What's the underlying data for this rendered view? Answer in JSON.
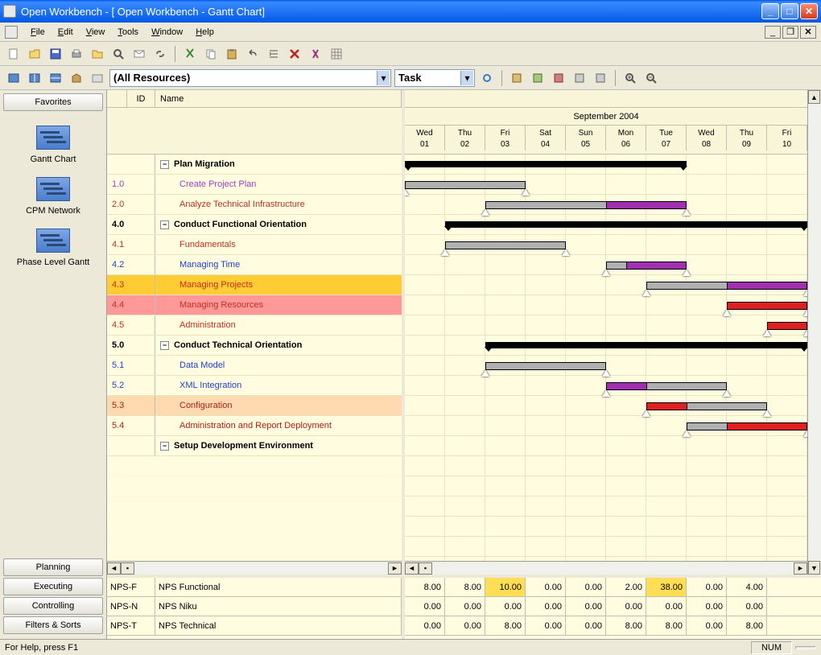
{
  "window": {
    "title": "Open Workbench - [   Open Workbench - Gantt Chart]"
  },
  "menu": {
    "file": "File",
    "edit": "Edit",
    "view": "View",
    "tools": "Tools",
    "window": "Window",
    "help": "Help"
  },
  "toolbar2": {
    "resources_combo": "(All Resources)",
    "view_type_combo": "Task"
  },
  "sidebar": {
    "categories": {
      "favorites": "Favorites",
      "planning": "Planning",
      "executing": "Executing",
      "controlling": "Controlling",
      "filters": "Filters & Sorts"
    },
    "views": [
      {
        "label": "Gantt Chart"
      },
      {
        "label": "CPM Network"
      },
      {
        "label": "Phase Level Gantt"
      }
    ]
  },
  "grid": {
    "headers": {
      "id": "ID",
      "name": "Name"
    },
    "month": "September 2004",
    "days": [
      {
        "dow": "Wed",
        "num": "01"
      },
      {
        "dow": "Thu",
        "num": "02"
      },
      {
        "dow": "Fri",
        "num": "03"
      },
      {
        "dow": "Sat",
        "num": "04"
      },
      {
        "dow": "Sun",
        "num": "05"
      },
      {
        "dow": "Mon",
        "num": "06"
      },
      {
        "dow": "Tue",
        "num": "07"
      },
      {
        "dow": "Wed",
        "num": "08"
      },
      {
        "dow": "Thu",
        "num": "09"
      },
      {
        "dow": "Fri",
        "num": "10"
      }
    ],
    "tasks": [
      {
        "id": "",
        "name": "Plan Migration",
        "bold": true,
        "toggle": true
      },
      {
        "id": "1.0",
        "name": "Create Project Plan",
        "color": "c-purple"
      },
      {
        "id": "2.0",
        "name": "Analyze Technical Infrastructure",
        "color": "c-red"
      },
      {
        "id": "4.0",
        "name": "Conduct Functional Orientation",
        "bold": true,
        "toggle": true
      },
      {
        "id": "4.1",
        "name": "Fundamentals",
        "color": "c-red"
      },
      {
        "id": "4.2",
        "name": "Managing Time",
        "color": "c-blue"
      },
      {
        "id": "4.3",
        "name": "Managing Projects",
        "color": "c-red",
        "hl": "hl-orange"
      },
      {
        "id": "4.4",
        "name": "Managing Resources",
        "color": "c-red",
        "hl": "hl-pink"
      },
      {
        "id": "4.5",
        "name": "Administration",
        "color": "c-red"
      },
      {
        "id": "5.0",
        "name": "Conduct Technical Orientation",
        "bold": true,
        "toggle": true
      },
      {
        "id": "5.1",
        "name": "Data Model",
        "color": "c-blue"
      },
      {
        "id": "5.2",
        "name": "XML Integration",
        "color": "c-blue"
      },
      {
        "id": "5.3",
        "name": "Configuration",
        "color": "c-dred",
        "hl": "hl-lred"
      },
      {
        "id": "5.4",
        "name": "Administration and Report Deployment",
        "color": "c-dred"
      },
      {
        "id": "",
        "name": "Setup Development Environment",
        "bold": true,
        "toggle": true
      }
    ]
  },
  "resources": {
    "rows": [
      {
        "code": "NPS-F",
        "name": "NPS Functional",
        "values": [
          "8.00",
          "8.00",
          "10.00",
          "0.00",
          "0.00",
          "2.00",
          "38.00",
          "0.00",
          "4.00"
        ]
      },
      {
        "code": "NPS-N",
        "name": "NPS Niku",
        "values": [
          "0.00",
          "0.00",
          "0.00",
          "0.00",
          "0.00",
          "0.00",
          "0.00",
          "0.00",
          "0.00"
        ]
      },
      {
        "code": "NPS-T",
        "name": "NPS Technical",
        "values": [
          "0.00",
          "0.00",
          "8.00",
          "0.00",
          "0.00",
          "8.00",
          "8.00",
          "0.00",
          "8.00"
        ]
      }
    ],
    "highlight": {
      "row": 0,
      "cols": [
        2,
        6
      ]
    }
  },
  "status": {
    "help": "For Help, press F1",
    "num": "NUM"
  },
  "chart_data": {
    "type": "gantt",
    "title": "Open Workbench - Gantt Chart",
    "time_axis": {
      "label": "September 2004",
      "ticks": [
        "01",
        "02",
        "03",
        "04",
        "05",
        "06",
        "07",
        "08",
        "09",
        "10"
      ]
    },
    "tasks": [
      {
        "id": "",
        "name": "Plan Migration",
        "summary": true,
        "start": "01",
        "end": "07"
      },
      {
        "id": "1.0",
        "name": "Create Project Plan",
        "start": "01",
        "end": "03",
        "color": "gray"
      },
      {
        "id": "2.0",
        "name": "Analyze Technical Infrastructure",
        "start": "03",
        "end": "07",
        "segments": [
          {
            "c": "gray",
            "s": "03",
            "e": "06"
          },
          {
            "c": "purple",
            "s": "06",
            "e": "07"
          }
        ]
      },
      {
        "id": "4.0",
        "name": "Conduct Functional Orientation",
        "summary": true,
        "start": "02",
        "end": "10"
      },
      {
        "id": "4.1",
        "name": "Fundamentals",
        "start": "02",
        "end": "04",
        "color": "gray"
      },
      {
        "id": "4.2",
        "name": "Managing Time",
        "start": "06",
        "end": "07",
        "segments": [
          {
            "c": "gray",
            "s": "06",
            "e": "06.5"
          },
          {
            "c": "purple",
            "s": "06.5",
            "e": "07"
          }
        ]
      },
      {
        "id": "4.3",
        "name": "Managing Projects",
        "start": "07",
        "end": "10",
        "segments": [
          {
            "c": "gray",
            "s": "07",
            "e": "09"
          },
          {
            "c": "purple",
            "s": "09",
            "e": "10"
          }
        ]
      },
      {
        "id": "4.4",
        "name": "Managing Resources",
        "start": "09",
        "end": "10",
        "color": "red"
      },
      {
        "id": "4.5",
        "name": "Administration",
        "start": "10",
        "end": "10",
        "color": "red"
      },
      {
        "id": "5.0",
        "name": "Conduct Technical Orientation",
        "summary": true,
        "start": "03",
        "end": "10"
      },
      {
        "id": "5.1",
        "name": "Data Model",
        "start": "03",
        "end": "05",
        "color": "gray"
      },
      {
        "id": "5.2",
        "name": "XML Integration",
        "start": "06",
        "end": "08",
        "segments": [
          {
            "c": "purple",
            "s": "06",
            "e": "07"
          },
          {
            "c": "gray",
            "s": "07",
            "e": "08"
          }
        ]
      },
      {
        "id": "5.3",
        "name": "Configuration",
        "start": "07",
        "end": "09",
        "segments": [
          {
            "c": "red",
            "s": "07",
            "e": "08"
          },
          {
            "c": "gray",
            "s": "08",
            "e": "09"
          }
        ]
      },
      {
        "id": "5.4",
        "name": "Administration and Report Deployment",
        "start": "08",
        "end": "10",
        "segments": [
          {
            "c": "gray",
            "s": "08",
            "e": "09"
          },
          {
            "c": "red",
            "s": "09",
            "e": "10"
          }
        ]
      },
      {
        "id": "",
        "name": "Setup Development Environment",
        "summary": true
      }
    ]
  }
}
